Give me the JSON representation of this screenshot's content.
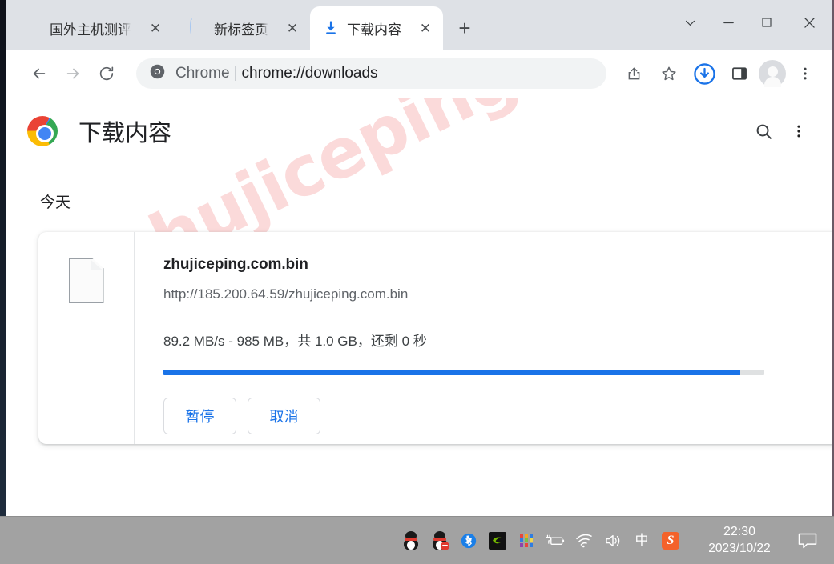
{
  "browser": {
    "tabs": [
      {
        "title": "国外主机测评",
        "favicon": "site-favicon-red",
        "close_label": "✕",
        "active": false,
        "loading": false
      },
      {
        "title": "新标签页",
        "favicon": "loading-spinner",
        "close_label": "✕",
        "active": false,
        "loading": true
      },
      {
        "title": "下载内容",
        "favicon": "download-icon",
        "close_label": "✕",
        "active": true,
        "loading": false
      }
    ],
    "new_tab_label": "+",
    "window_controls": {
      "tab_search": "tab-search-chevron",
      "minimize": "minimize",
      "maximize": "maximize",
      "close": "close"
    },
    "toolbar": {
      "back": "back-arrow",
      "forward": "forward-arrow",
      "reload": "reload",
      "omnibox_scheme": "Chrome",
      "omnibox_separator": "|",
      "omnibox_url": "chrome://downloads",
      "share_icon": "share-icon",
      "bookmark_icon": "star-icon",
      "downloads_icon": "downloads-icon",
      "side_panel_icon": "side-panel-icon",
      "profile_icon": "avatar-icon",
      "menu_icon": "three-dot-menu-icon"
    }
  },
  "downloads_page": {
    "logo": "chrome-logo",
    "title": "下载内容",
    "search_icon": "search-icon",
    "menu_icon": "three-dot-menu-icon",
    "section_label": "今天",
    "watermark": "zhujiceping.com",
    "item": {
      "file_icon": "generic-file-icon",
      "file_name": "zhujiceping.com.bin",
      "url": "http://185.200.64.59/zhujiceping.com.bin",
      "status": "89.2 MB/s - 985 MB，共 1.0 GB，还剩 0 秒",
      "progress_percent": 96,
      "progress_color": "#1a73e8",
      "pause_label": "暂停",
      "cancel_label": "取消"
    }
  },
  "taskbar": {
    "tray_icons": [
      "qq-icon",
      "qq-muted-icon",
      "bluetooth-icon",
      "nvidia-icon",
      "color-dots-icon",
      "power-battery-icon",
      "wifi-icon",
      "volume-icon",
      "ime-chinese-icon",
      "sogou-icon"
    ],
    "ime_label": "中",
    "sogou_label": "S",
    "clock_time": "22:30",
    "clock_date": "2023/10/22",
    "notification_icon": "notification-icon"
  }
}
